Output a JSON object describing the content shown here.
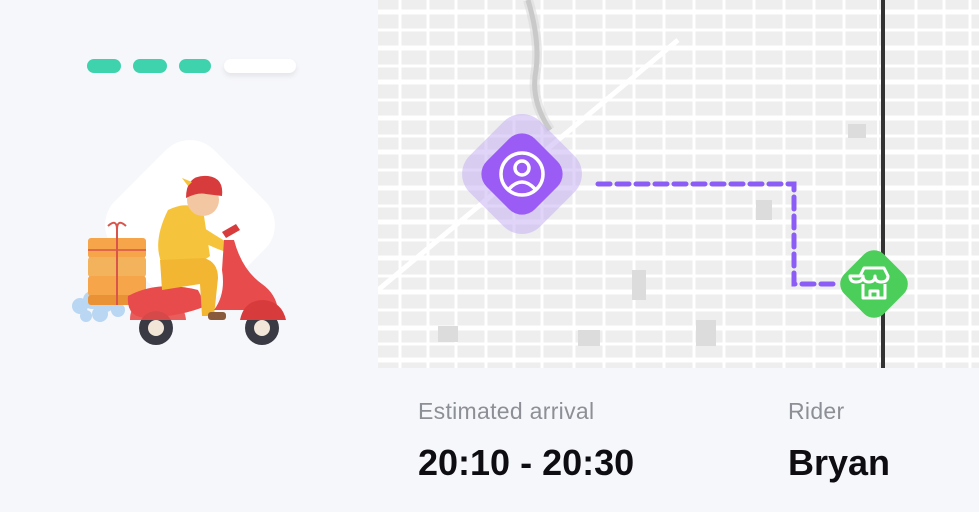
{
  "progress": {
    "steps": [
      {
        "state": "done"
      },
      {
        "state": "done"
      },
      {
        "state": "done"
      },
      {
        "state": "pending"
      }
    ],
    "completed": 3,
    "total": 4,
    "colors": {
      "done": "#3fd3ad",
      "pending": "#ffffff"
    }
  },
  "illustration": {
    "icon": "delivery-rider-scooter-illustration"
  },
  "map": {
    "user_marker": {
      "icon": "user-profile-icon",
      "color": "#9b5cf6"
    },
    "store_marker": {
      "icon": "storefront-icon",
      "color": "#4ccf5a"
    },
    "route_color": "#8b5cf6"
  },
  "delivery": {
    "estimated_arrival_label": "Estimated arrival",
    "estimated_arrival_value": "20:10 - 20:30",
    "rider_label": "Rider",
    "rider_name": "Bryan"
  }
}
